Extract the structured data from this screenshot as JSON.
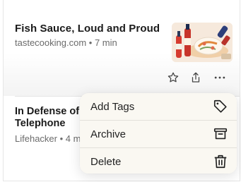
{
  "articles": [
    {
      "title": "Fish Sauce, Loud and Proud",
      "meta": "tastecooking.com • 7 min"
    },
    {
      "title": "In Defense of Telephone",
      "meta": "Lifehacker • 4 m"
    }
  ],
  "actions": {
    "icons": [
      "star-icon",
      "share-icon",
      "more-icon"
    ]
  },
  "menu": {
    "items": [
      {
        "label": "Add Tags",
        "icon": "tag-icon"
      },
      {
        "label": "Archive",
        "icon": "archive-icon"
      },
      {
        "label": "Delete",
        "icon": "trash-icon"
      }
    ]
  }
}
